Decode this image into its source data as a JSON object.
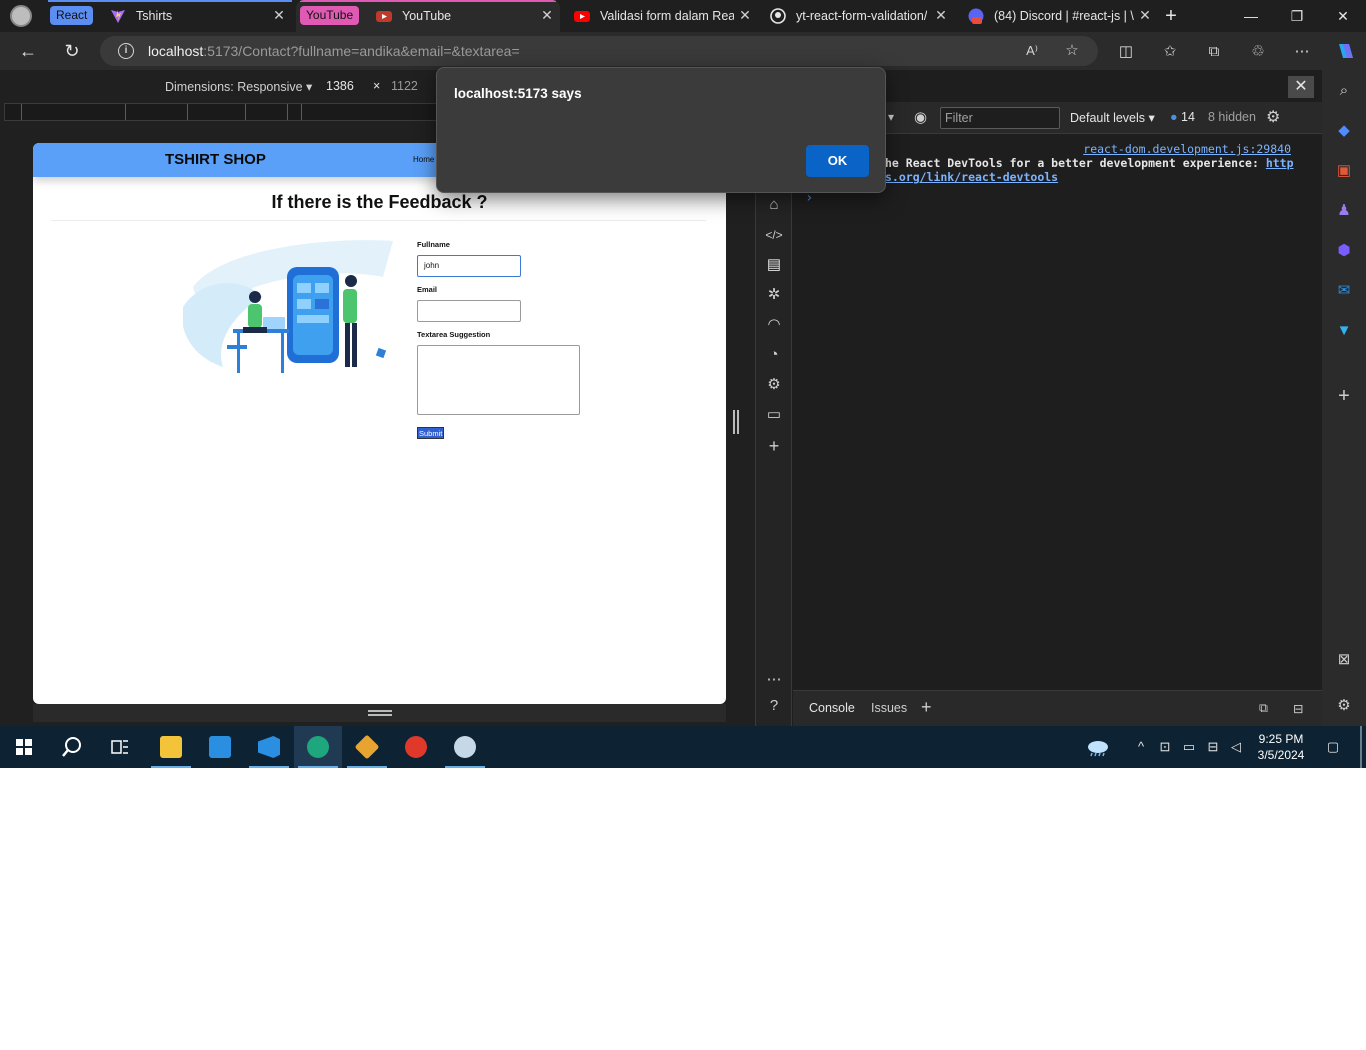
{
  "browser": {
    "tabs": [
      {
        "group": "React",
        "title": "Tshirts",
        "active": false
      },
      {
        "group": "YouTube",
        "title": "YouTube",
        "active": true
      },
      {
        "title": "Validasi form dalam Reac",
        "active": false
      },
      {
        "title": "yt-react-form-validation/",
        "active": false
      },
      {
        "title": "(84) Discord | #react-js | \\",
        "active": false
      }
    ],
    "url_host": "localhost",
    "url_rest": ":5173/Contact?fullname=andika&email=&textarea=",
    "colors": {
      "react_group": "#5b8ef0",
      "youtube_group": "#e05ab4"
    }
  },
  "device_toolbar": {
    "dimensions_label": "Dimensions: Responsive",
    "width": "1386",
    "separator": "×",
    "height": "1122"
  },
  "site": {
    "brand": "TSHIRT SHOP",
    "nav_home": "Home",
    "title": "If there is the Feedback ?",
    "form": {
      "fullname_label": "Fullname",
      "fullname_value": "john",
      "email_label": "Email",
      "email_value": "",
      "textarea_label": "Textarea Suggestion",
      "textarea_value": "",
      "submit_label": "Submit"
    }
  },
  "alert": {
    "title": "localhost:5173 says",
    "ok_label": "OK"
  },
  "devtools": {
    "filter_placeholder": "Filter",
    "levels_label": "Default levels",
    "issues_count": "14",
    "hidden_label": "8 hidden",
    "console_source": "react-dom.development.js:29840",
    "console_message": "he React DevTools for a better development experience:",
    "console_link_a": "http",
    "console_link_b": "s.org/link/react-devtools",
    "drawer_tabs": [
      "Console",
      "Issues"
    ]
  },
  "taskbar": {
    "time": "9:25 PM",
    "date": "3/5/2024"
  }
}
